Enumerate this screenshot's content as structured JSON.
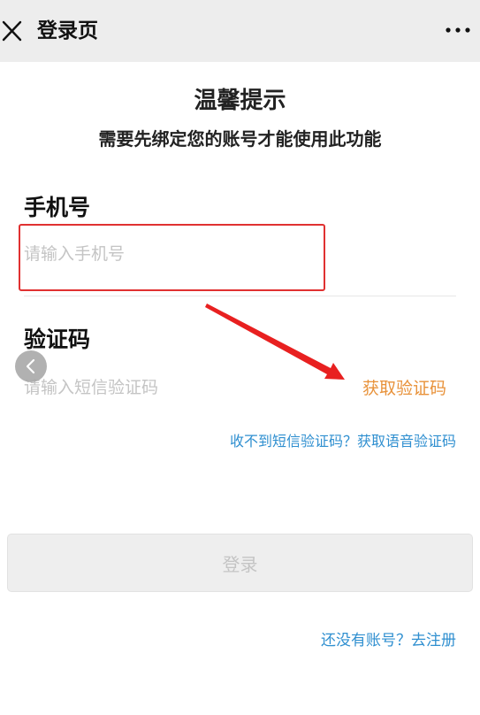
{
  "navbar": {
    "title": "登录页",
    "close_icon": "close-icon",
    "more_icon": "more-dots-icon"
  },
  "tip": {
    "title": "温馨提示",
    "subtitle": "需要先绑定您的账号才能使用此功能"
  },
  "phone": {
    "label": "手机号",
    "value": "",
    "placeholder": "请输入手机号"
  },
  "code": {
    "label": "验证码",
    "value": "",
    "placeholder": "请输入短信验证码",
    "get_code_label": "获取验证码"
  },
  "voice_link": "收不到短信验证码？获取语音验证码",
  "login_button": "登录",
  "register_link": "还没有账号？去注册",
  "annotations": {
    "highlight_color": "#e03131",
    "arrow_color": "#e82020"
  },
  "colors": {
    "link": "#2f8fd0",
    "get_code": "#e8923a",
    "navbar_bg": "#ededed",
    "login_disabled_text": "#c4c4c4"
  }
}
